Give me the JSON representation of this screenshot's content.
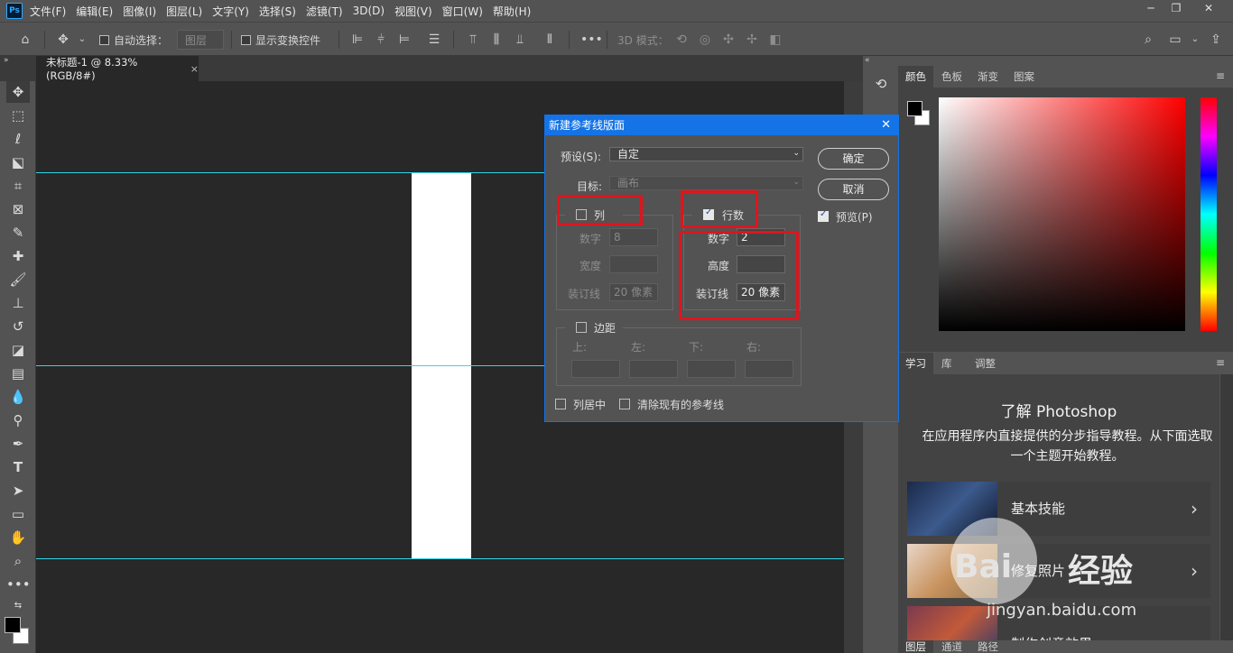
{
  "menubar": {
    "logo": "Ps",
    "items": [
      "文件(F)",
      "编辑(E)",
      "图像(I)",
      "图层(L)",
      "文字(Y)",
      "选择(S)",
      "滤镜(T)",
      "3D(D)",
      "视图(V)",
      "窗口(W)",
      "帮助(H)"
    ]
  },
  "options": {
    "auto_select": "自动选择：",
    "layer_select": "图层",
    "show_transform": "显示变换控件",
    "mode_3d": "3D 模式："
  },
  "document": {
    "tab_title": "未标题-1 @ 8.33%(RGB/8#)"
  },
  "dialog": {
    "title": "新建参考线版面",
    "preset_label": "预设(S):",
    "preset_value": "自定",
    "target_label": "目标:",
    "target_value": "画布",
    "columns_label": "列",
    "rows_label": "行数",
    "col_number_label": "数字",
    "col_number_value": "8",
    "col_width_label": "宽度",
    "col_width_value": "",
    "col_gutter_label": "装订线",
    "col_gutter_value": "20 像素",
    "row_number_label": "数字",
    "row_number_value": "2",
    "row_height_label": "高度",
    "row_height_value": "",
    "row_gutter_label": "装订线",
    "row_gutter_value": "20 像素",
    "margin_label": "边距",
    "margin_top": "上:",
    "margin_left": "左:",
    "margin_bottom": "下:",
    "margin_right": "右:",
    "center_cols": "列居中",
    "clear_guides": "清除现有的参考线",
    "ok": "确定",
    "cancel": "取消",
    "preview": "预览(P)"
  },
  "panels": {
    "top_tabs": [
      "颜色",
      "色板",
      "渐变",
      "图案"
    ],
    "mid_tabs": [
      "学习",
      "库",
      "调整"
    ],
    "bottom_tabs": [
      "图层",
      "通道",
      "路径"
    ],
    "learn_title": "了解 Photoshop",
    "learn_desc": "在应用程序内直接提供的分步指导教程。从下面选取一个主题开始教程。",
    "cards": [
      "基本技能",
      "修复照片",
      "制作创意效果"
    ]
  },
  "watermark": {
    "brand": "Bai",
    "cn": "经验",
    "url": "jingyan.baidu.com"
  },
  "colors": {
    "accent": "#1473e6",
    "guide": "#35d5e6",
    "highlight": "#e0141c"
  }
}
